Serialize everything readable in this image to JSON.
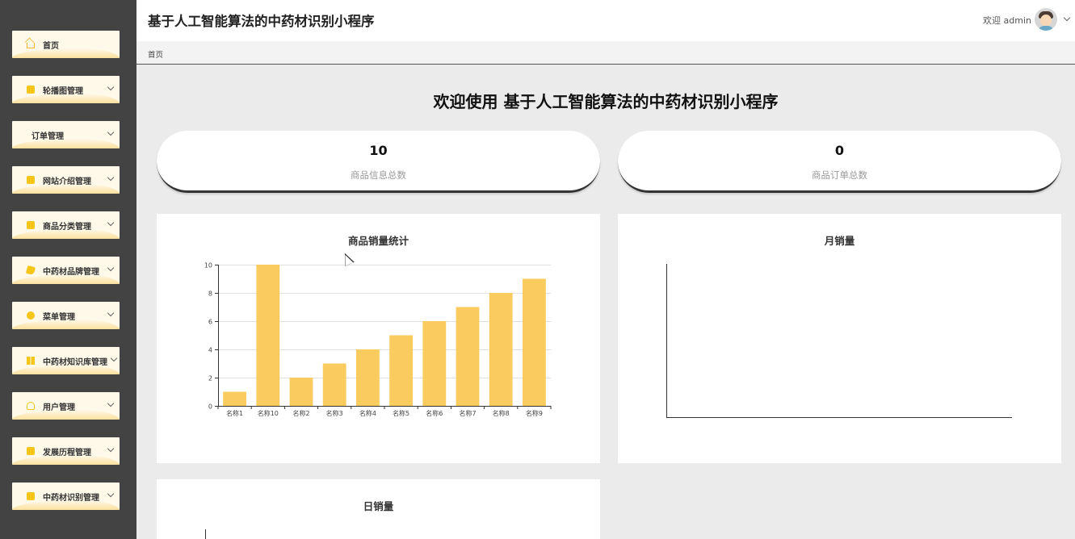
{
  "header": {
    "app_title": "基于人工智能算法的中药材识别小程序",
    "welcome": "欢迎 admin"
  },
  "breadcrumb": {
    "home": "首页"
  },
  "sidebar": {
    "items": [
      {
        "label": "首页",
        "icon": "home-icon",
        "has_submenu": false
      },
      {
        "label": "轮播图管理",
        "icon": "gift-icon",
        "has_submenu": true
      },
      {
        "label": "订单管理",
        "icon": "",
        "has_submenu": true
      },
      {
        "label": "网站介绍管理",
        "icon": "folder-icon",
        "has_submenu": true
      },
      {
        "label": "商品分类管理",
        "icon": "book-icon",
        "has_submenu": true
      },
      {
        "label": "中药材品牌管理",
        "icon": "tag-icon",
        "has_submenu": true
      },
      {
        "label": "菜单管理",
        "icon": "circle-icon",
        "has_submenu": true
      },
      {
        "label": "中药材知识库管理",
        "icon": "grid-icon",
        "has_submenu": true
      },
      {
        "label": "用户管理",
        "icon": "user-icon",
        "has_submenu": true
      },
      {
        "label": "发展历程管理",
        "icon": "folder-icon",
        "has_submenu": true
      },
      {
        "label": "中药材识别管理",
        "icon": "box-icon",
        "has_submenu": true
      }
    ]
  },
  "main": {
    "welcome_title": "欢迎使用 基于人工智能算法的中药材识别小程序",
    "stats": [
      {
        "value": "10",
        "label": "商品信息总数"
      },
      {
        "value": "0",
        "label": "商品订单总数"
      }
    ],
    "panels": {
      "sales": "商品销量统计",
      "monthly": "月销量",
      "daily": "日销量"
    }
  },
  "colors": {
    "accent": "#facb5f",
    "sidebar_bg": "#434343",
    "menu_bg": "#fff9ea"
  },
  "chart_data": [
    {
      "type": "bar",
      "title": "商品销量统计",
      "categories": [
        "名称1",
        "名称10",
        "名称2",
        "名称3",
        "名称4",
        "名称5",
        "名称6",
        "名称7",
        "名称8",
        "名称9"
      ],
      "values": [
        1,
        10,
        2,
        3,
        4,
        5,
        6,
        7,
        8,
        9
      ],
      "ylim": [
        0,
        10
      ],
      "yticks": [
        0,
        2,
        4,
        6,
        8,
        10
      ],
      "grid": true,
      "color": "#facb5f"
    },
    {
      "type": "line",
      "title": "月销量",
      "series": []
    },
    {
      "type": "line",
      "title": "日销量",
      "series": []
    }
  ]
}
